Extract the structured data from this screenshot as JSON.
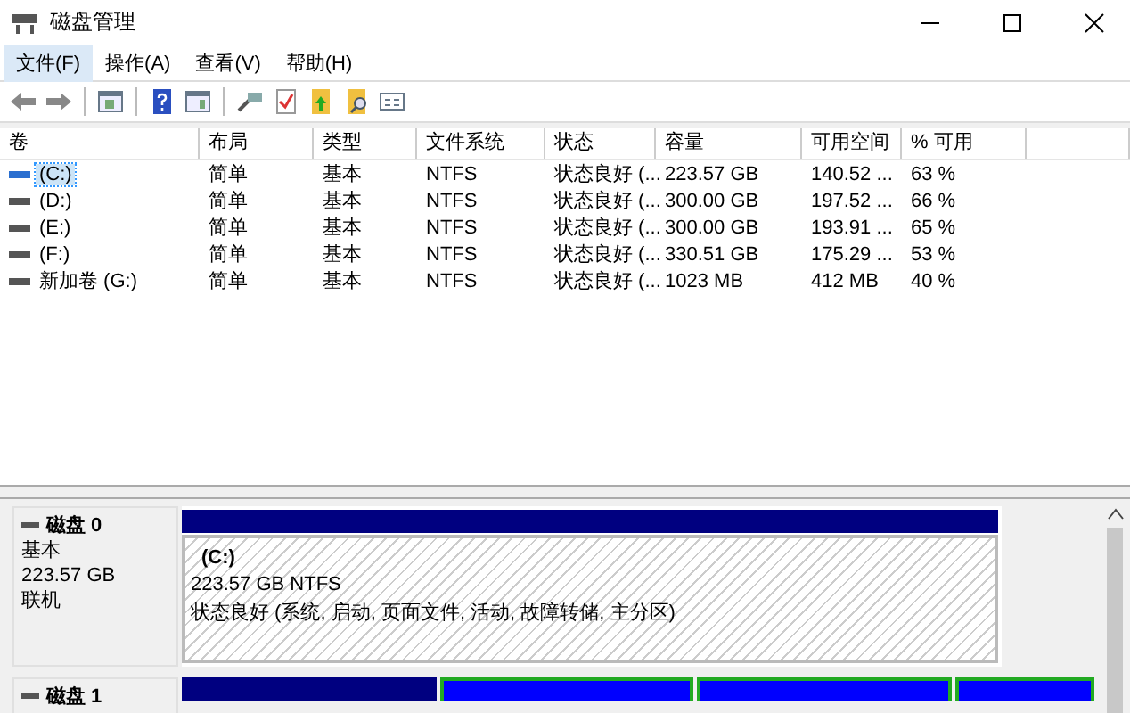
{
  "window": {
    "title": "磁盘管理"
  },
  "menu": [
    {
      "label": "文件(F)",
      "selected": true
    },
    {
      "label": "操作(A)",
      "selected": false
    },
    {
      "label": "查看(V)",
      "selected": false
    },
    {
      "label": "帮助(H)",
      "selected": false
    }
  ],
  "toolbar": [
    {
      "kind": "back"
    },
    {
      "kind": "forward"
    },
    {
      "kind": "sep"
    },
    {
      "kind": "tree"
    },
    {
      "kind": "sep"
    },
    {
      "kind": "help"
    },
    {
      "kind": "panel"
    },
    {
      "kind": "sep"
    },
    {
      "kind": "connect"
    },
    {
      "kind": "check"
    },
    {
      "kind": "folderup"
    },
    {
      "kind": "foldersearch"
    },
    {
      "kind": "props"
    }
  ],
  "table": {
    "columns": [
      "卷",
      "布局",
      "类型",
      "文件系统",
      "状态",
      "容量",
      "可用空间",
      "% 可用"
    ],
    "rows": [
      {
        "selected": true,
        "cells": [
          "(C:)",
          "简单",
          "基本",
          "NTFS",
          "状态良好 (...",
          "223.57 GB",
          "140.52 ...",
          "63 %"
        ]
      },
      {
        "selected": false,
        "cells": [
          "(D:)",
          "简单",
          "基本",
          "NTFS",
          "状态良好 (...",
          "300.00 GB",
          "197.52 ...",
          "66 %"
        ]
      },
      {
        "selected": false,
        "cells": [
          "(E:)",
          "简单",
          "基本",
          "NTFS",
          "状态良好 (...",
          "300.00 GB",
          "193.91 ...",
          "65 %"
        ]
      },
      {
        "selected": false,
        "cells": [
          "(F:)",
          "简单",
          "基本",
          "NTFS",
          "状态良好 (...",
          "330.51 GB",
          "175.29 ...",
          "53 %"
        ]
      },
      {
        "selected": false,
        "cells": [
          "新加卷 (G:)",
          "简单",
          "基本",
          "NTFS",
          "状态良好 (...",
          "1023 MB",
          "412 MB",
          "40 %"
        ]
      }
    ]
  },
  "disks": [
    {
      "name": "磁盘 0",
      "info": [
        "基本",
        "223.57 GB",
        "联机"
      ],
      "partitions": [
        {
          "kind": "primary",
          "label": "(C:)",
          "size": "223.57 GB NTFS",
          "status": "状态良好 (系统, 启动, 页面文件, 活动, 故障转储, 主分区)"
        }
      ]
    },
    {
      "name": "磁盘 1",
      "partitions": [
        {
          "kind": "primary"
        },
        {
          "kind": "logical"
        },
        {
          "kind": "logical"
        },
        {
          "kind": "logical"
        }
      ]
    }
  ]
}
